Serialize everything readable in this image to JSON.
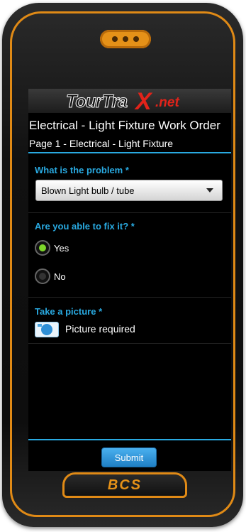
{
  "brand_text": "BCS",
  "logo": {
    "part1": "TourTra",
    "part2": "X",
    "part3": ".net"
  },
  "form": {
    "title": "Electrical - Light Fixture Work Order",
    "subtitle": "Page 1 - Electrical - Light Fixture"
  },
  "questions": {
    "problem": {
      "label": "What is the problem *",
      "selected": "Blown Light bulb / tube"
    },
    "fix": {
      "label": "Are you able to fix it? *",
      "options": [
        {
          "label": "Yes",
          "selected": true
        },
        {
          "label": "No",
          "selected": false
        }
      ]
    },
    "picture": {
      "label": "Take a picture *",
      "status": "Picture required",
      "icon": "camera-icon"
    }
  },
  "submit_label": "Submit",
  "colors": {
    "accent": "#29a9e0",
    "radio_selected": "#7dd62a",
    "trim": "#e08a16"
  }
}
